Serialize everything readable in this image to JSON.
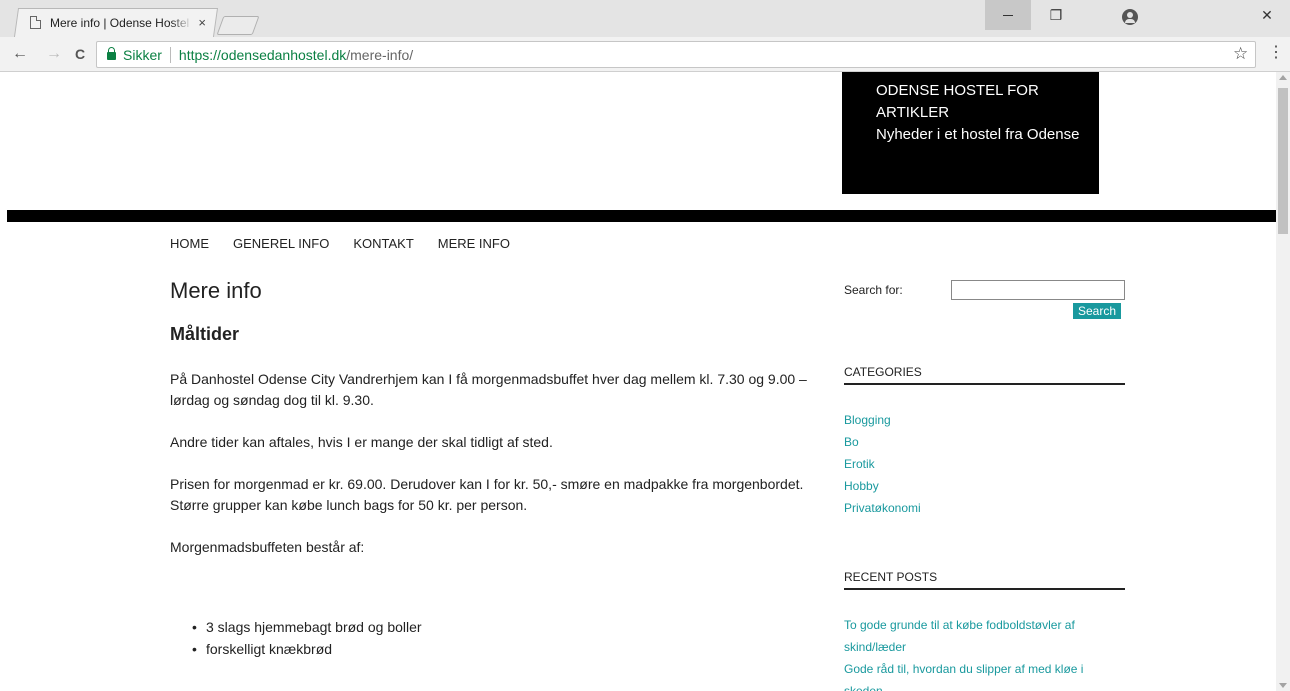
{
  "browser": {
    "tab_title": "Mere info | Odense Hostel",
    "tab_close": "×",
    "back": "←",
    "forward": "→",
    "reload": "C",
    "secure_label": "Sikker",
    "url_host": "https://odensedanhostel.dk",
    "url_path": "/mere-info/",
    "star": "☆",
    "menu": "⋮",
    "restore": "❐",
    "close": "✕"
  },
  "header": {
    "badge_line1": "ODENSE HOSTEL FOR ARTIKLER",
    "badge_line2": "Nyheder i et hostel fra Odense"
  },
  "nav": {
    "items": [
      "HOME",
      "GENEREL INFO",
      "KONTAKT",
      "MERE INFO"
    ]
  },
  "main": {
    "page_title": "Mere info",
    "section_title": "Måltider",
    "paragraphs": [
      "På Danhostel Odense City Vandrerhjem kan I få morgenmadsbuffet hver dag mellem kl. 7.30 og 9.00 – lørdag og søndag dog til kl. 9.30.",
      "Andre tider kan aftales, hvis I er mange der skal tidligt af sted.",
      "Prisen for morgenmad er kr. 69.00. Derudover kan I for kr. 50,- smøre en madpakke fra morgenbordet. Større grupper kan købe lunch bags for 50 kr. per person.",
      "Morgenmadsbuffeten består af:"
    ],
    "list": [
      "3 slags hjemmebagt brød og boller",
      "forskelligt knækbrød"
    ]
  },
  "sidebar": {
    "search_label": "Search for:",
    "search_value": "",
    "search_button": "Search",
    "categories_title": "CATEGORIES",
    "categories": [
      "Blogging",
      "Bo",
      "Erotik",
      "Hobby",
      "Privatøkonomi"
    ],
    "recent_title": "RECENT POSTS",
    "recent_posts": [
      "To gode grunde til at købe fodboldstøvler af skind/læder",
      "Gode råd til, hvordan du slipper af med kløe i skeden"
    ]
  },
  "colors": {
    "accent": "#19999e",
    "secure_green": "#0b8043",
    "badge_bg": "#000000"
  }
}
